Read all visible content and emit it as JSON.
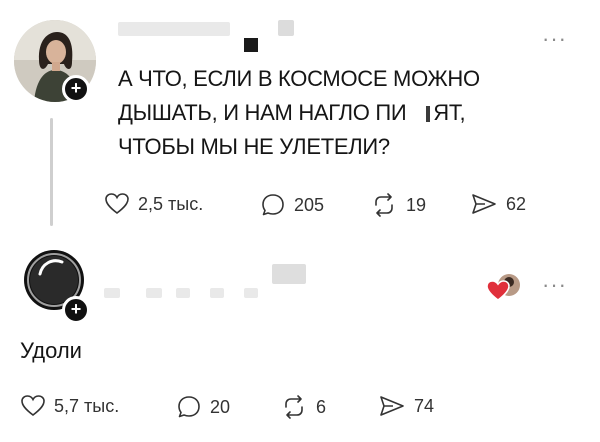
{
  "posts": [
    {
      "text_lines": [
        "А ЧТО, ЕСЛИ В КОСМОСЕ МОЖНО",
        "ДЫШАТЬ, И НАМ НАГЛО ПИ",
        "ЯТ,",
        "ЧТОБЫ МЫ НЕ УЛЕТЕЛИ?"
      ],
      "likes": "2,5 тыс.",
      "comments": "205",
      "reposts": "19",
      "shares": "62"
    },
    {
      "text": "Удоли",
      "likes": "5,7 тыс.",
      "comments": "20",
      "reposts": "6",
      "shares": "74"
    }
  ],
  "icons": {
    "like": "heart-outline-icon",
    "comment": "speech-bubble-icon",
    "repost": "repost-arrows-icon",
    "share": "send-arrow-icon",
    "more": "more-dots-icon",
    "follow": "plus-icon",
    "reaction": "red-heart-icon"
  },
  "colors": {
    "text": "#151515",
    "icon": "#333333",
    "reaction_heart": "#e0303b",
    "thread_line": "#cfcfcf"
  },
  "symbols": {
    "more": "···",
    "plus": "+"
  }
}
